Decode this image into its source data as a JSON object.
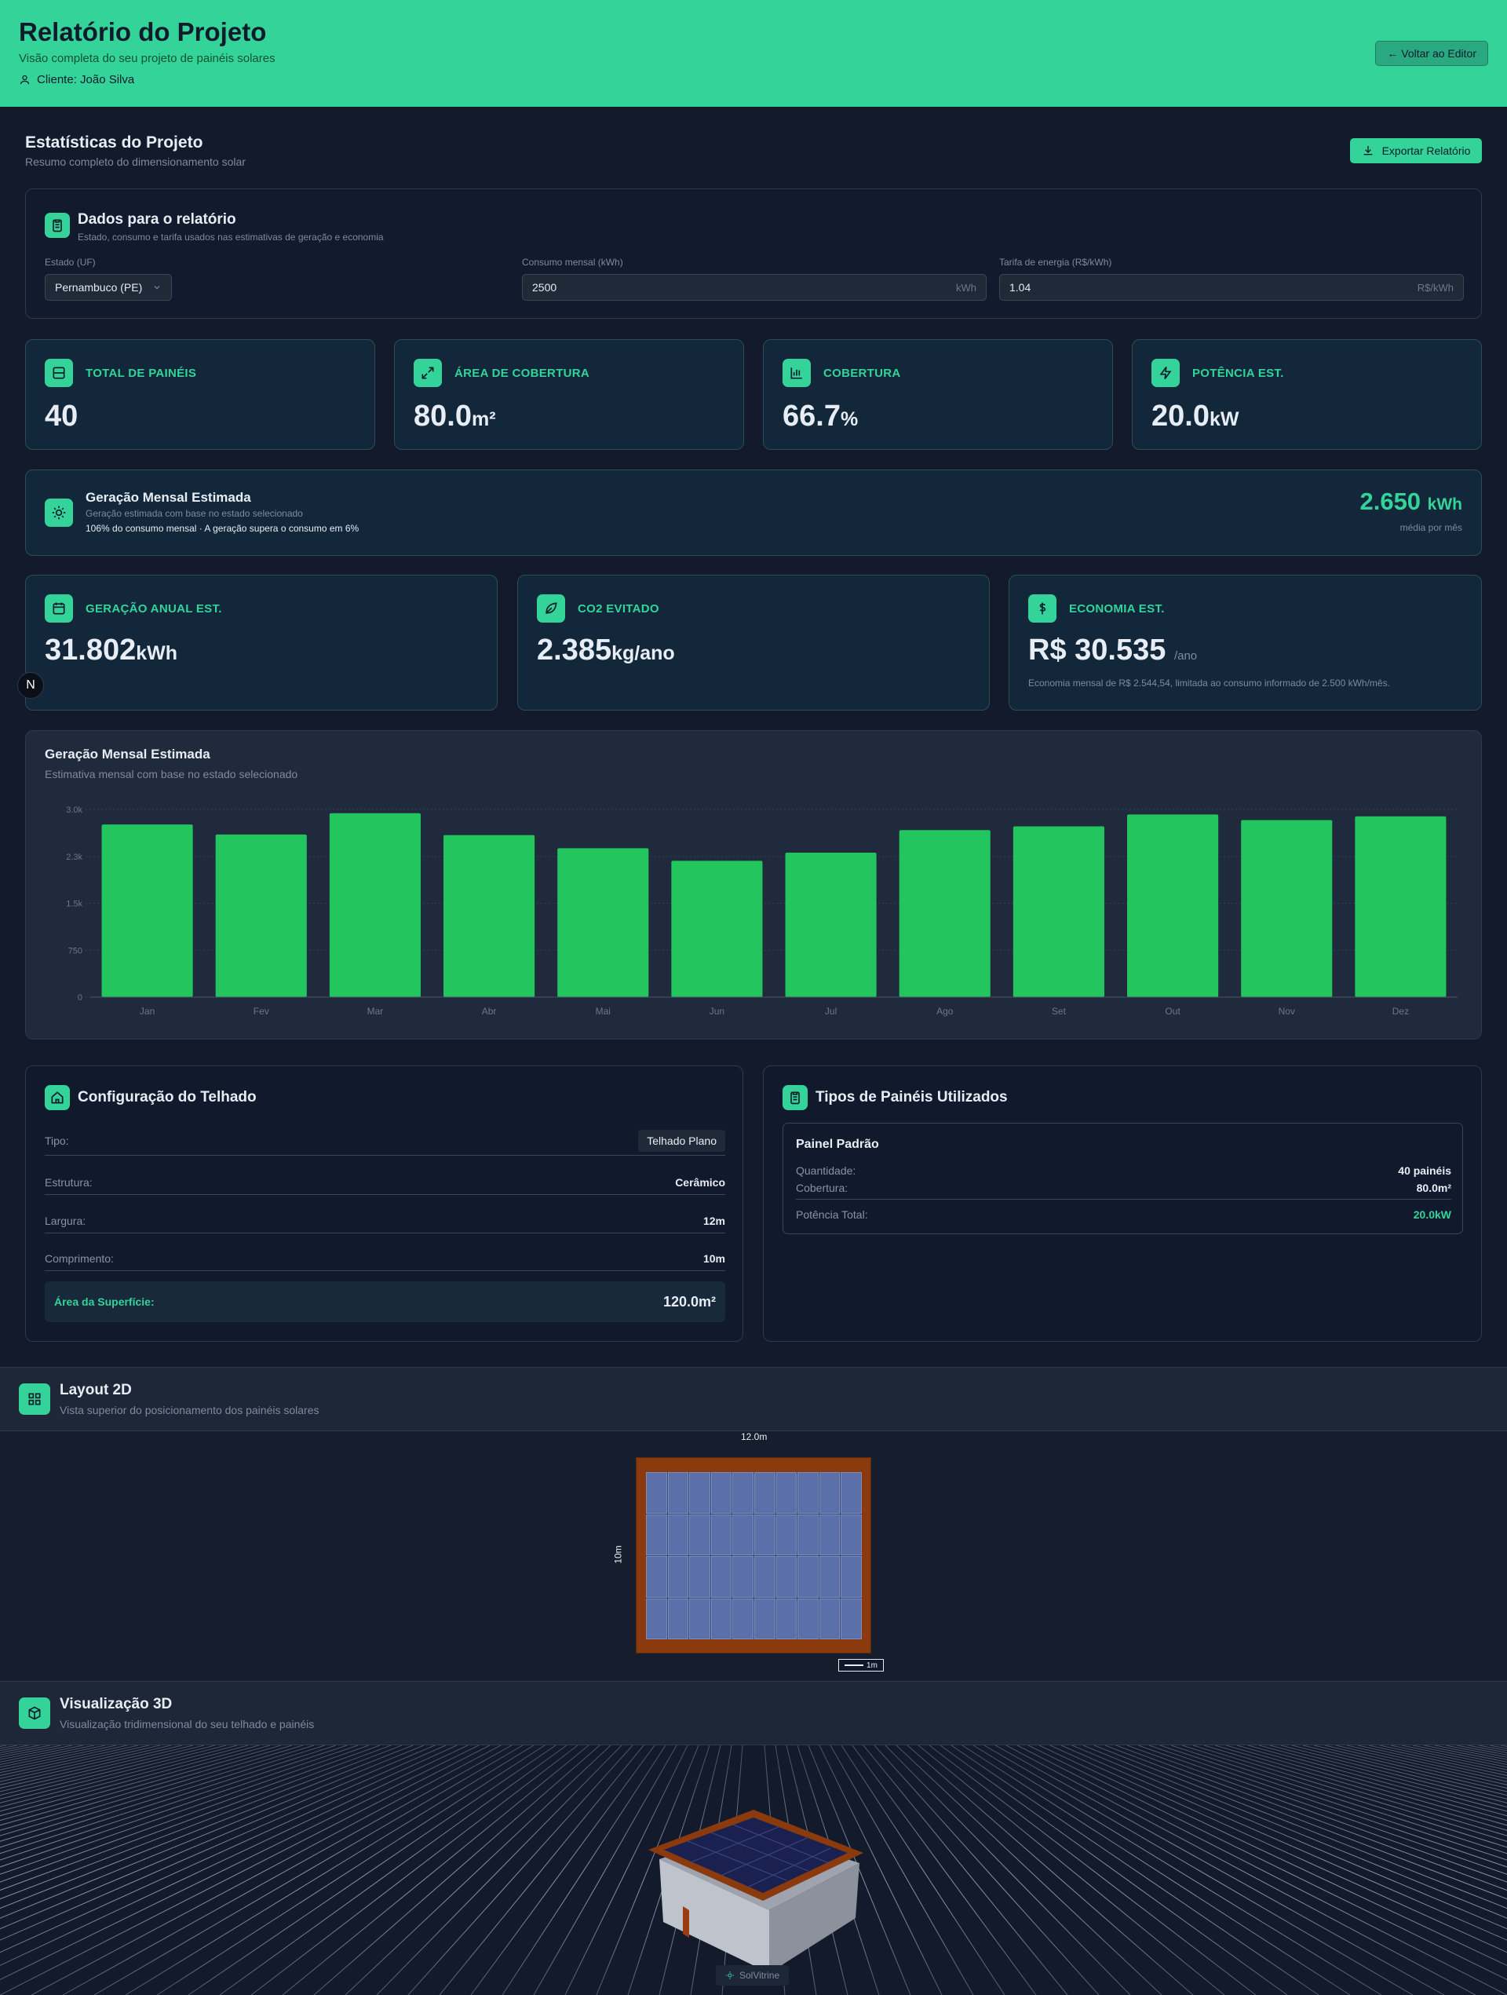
{
  "header": {
    "title": "Relatório do Projeto",
    "subtitle": "Visão completa do seu projeto de painéis solares",
    "client": "Cliente: João Silva",
    "back_button": "← Voltar ao Editor"
  },
  "stats": {
    "title": "Estatísticas do Projeto",
    "subtitle": "Resumo completo do dimensionamento solar",
    "export_button": "Exportar Relatório"
  },
  "report_data": {
    "title": "Dados para o relatório",
    "subtitle": "Estado, consumo e tarifa usados nas estimativas de geração e economia",
    "state_label": "Estado (UF)",
    "state_value": "Pernambuco (PE)",
    "consumption_label": "Consumo mensal (kWh)",
    "consumption_value": "2500",
    "consumption_unit": "kWh",
    "tariff_label": "Tarifa de energia (R$/kWh)",
    "tariff_value": "1.04",
    "tariff_unit": "R$/kWh"
  },
  "cards": [
    {
      "label": "TOTAL DE PAINÉIS",
      "value": "40",
      "unit": "",
      "icon": "panel-icon"
    },
    {
      "label": "ÁREA DE COBERTURA",
      "value": "80.0",
      "unit": "m²",
      "icon": "expand-icon"
    },
    {
      "label": "COBERTURA",
      "value": "66.7",
      "unit": "%",
      "icon": "bar-chart-icon"
    },
    {
      "label": "POTÊNCIA EST.",
      "value": "20.0",
      "unit": "kW",
      "icon": "zap-icon"
    }
  ],
  "monthly": {
    "title": "Geração Mensal Estimada",
    "subtitle": "Geração estimada com base no estado selecionado",
    "note": "106% do consumo mensal · A geração supera o consumo em 6%",
    "value": "2.650",
    "unit": "kWh",
    "caption": "média por mês"
  },
  "cards2": [
    {
      "label": "GERAÇÃO ANUAL EST.",
      "value": "31.802",
      "unit": "kWh",
      "icon": "calendar-icon"
    },
    {
      "label": "CO2 EVITADO",
      "value": "2.385",
      "unit": "kg/ano",
      "icon": "leaf-icon"
    },
    {
      "label": "ECONOMIA EST.",
      "value": "R$ 30.535",
      "unit": "/ano",
      "note": "Economia mensal de R$ 2.544,54, limitada ao consumo informado de 2.500 kWh/mês.",
      "icon": "dollar-icon"
    }
  ],
  "chart_data": {
    "type": "bar",
    "title": "Geração Mensal Estimada",
    "subtitle": "Estimativa mensal com base no estado selecionado",
    "categories": [
      "Jan",
      "Fev",
      "Mar",
      "Abr",
      "Mai",
      "Jun",
      "Jul",
      "Ago",
      "Set",
      "Out",
      "Nov",
      "Dez"
    ],
    "values": [
      2760,
      2600,
      2940,
      2590,
      2380,
      2180,
      2310,
      2670,
      2730,
      2920,
      2830,
      2890
    ],
    "yticks": [
      "0",
      "750",
      "1.5k",
      "2.3k",
      "3.0k"
    ],
    "ylim": [
      0,
      3000
    ],
    "color": "#22c55e",
    "grid": true
  },
  "roof": {
    "title": "Configuração do Telhado",
    "rows": [
      {
        "k": "Tipo:",
        "v": "Telhado Plano"
      },
      {
        "k": "Estrutura:",
        "v": "Cerâmico"
      },
      {
        "k": "Largura:",
        "v": "12m"
      },
      {
        "k": "Comprimento:",
        "v": "10m"
      }
    ],
    "area_label": "Área da Superfície:",
    "area_value": "120.0m²"
  },
  "panels": {
    "title": "Tipos de Painéis Utilizados",
    "name": "Painel Padrão",
    "qty_label": "Quantidade:",
    "qty_value": "40 painéis",
    "cov_label": "Cobertura:",
    "cov_value": "80.0m²",
    "pow_label": "Potência Total:",
    "pow_value": "20.0kW"
  },
  "layout2d": {
    "title": "Layout 2D",
    "subtitle": "Vista superior do posicionamento dos painéis solares",
    "width_label": "12.0m",
    "height_label": "10m",
    "scale_label": "1m",
    "columns": 10,
    "rows": 4
  },
  "view3d": {
    "title": "Visualização 3D",
    "subtitle": "Visualização tridimensional do seu telhado e painéis",
    "watermark": "SolVitrine"
  },
  "fab": {
    "label": "N"
  }
}
